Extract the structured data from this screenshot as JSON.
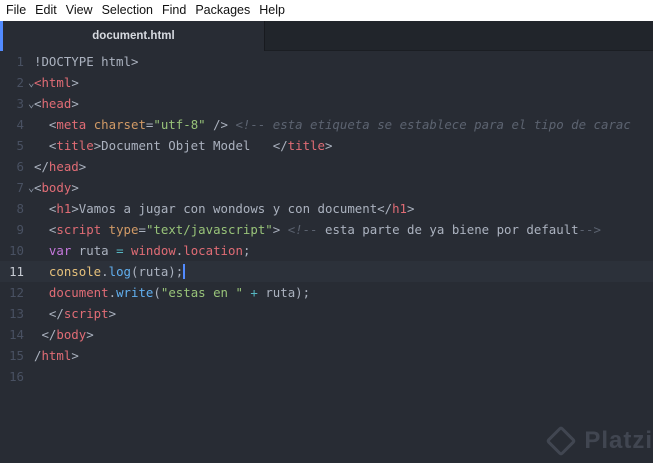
{
  "menu": [
    "File",
    "Edit",
    "View",
    "Selection",
    "Find",
    "Packages",
    "Help"
  ],
  "tab": {
    "title": "document.html"
  },
  "editor": {
    "current_line": 11,
    "lines": [
      {
        "n": "1",
        "fold": "",
        "tokens": [
          {
            "c": "c-txt",
            "t": "!DOCTYPE html>"
          }
        ]
      },
      {
        "n": "2",
        "fold": "⌄",
        "tokens": [
          {
            "c": "c-tag",
            "t": "<html"
          },
          {
            "c": "c-txt",
            "t": ">"
          }
        ]
      },
      {
        "n": "3",
        "fold": "⌄",
        "tokens": [
          {
            "c": "c-txt",
            "t": "<"
          },
          {
            "c": "c-tag",
            "t": "head"
          },
          {
            "c": "c-txt",
            "t": ">"
          }
        ]
      },
      {
        "n": "4",
        "fold": "",
        "tokens": [
          {
            "c": "c-txt",
            "t": "  <"
          },
          {
            "c": "c-tag",
            "t": "meta"
          },
          {
            "c": "c-txt",
            "t": " "
          },
          {
            "c": "c-attr",
            "t": "charset"
          },
          {
            "c": "c-txt",
            "t": "="
          },
          {
            "c": "c-str",
            "t": "\"utf-8\""
          },
          {
            "c": "c-txt",
            "t": " /> "
          },
          {
            "c": "c-com",
            "t": "<!-- esta etiqueta se establece para el tipo de carac"
          }
        ]
      },
      {
        "n": "5",
        "fold": "",
        "tokens": [
          {
            "c": "c-txt",
            "t": "  <"
          },
          {
            "c": "c-tag",
            "t": "title"
          },
          {
            "c": "c-txt",
            "t": ">Document Objet Model   </"
          },
          {
            "c": "c-tag",
            "t": "title"
          },
          {
            "c": "c-txt",
            "t": ">"
          }
        ]
      },
      {
        "n": "6",
        "fold": "",
        "tokens": [
          {
            "c": "c-txt",
            "t": "</"
          },
          {
            "c": "c-tag",
            "t": "head"
          },
          {
            "c": "c-txt",
            "t": ">"
          }
        ]
      },
      {
        "n": "7",
        "fold": "⌄",
        "tokens": [
          {
            "c": "c-txt",
            "t": "<"
          },
          {
            "c": "c-tag",
            "t": "body"
          },
          {
            "c": "c-txt",
            "t": ">"
          }
        ]
      },
      {
        "n": "8",
        "fold": "",
        "tokens": [
          {
            "c": "c-txt",
            "t": "  <"
          },
          {
            "c": "c-tag",
            "t": "h1"
          },
          {
            "c": "c-txt",
            "t": ">Vamos a jugar con wondows y con document</"
          },
          {
            "c": "c-tag",
            "t": "h1"
          },
          {
            "c": "c-txt",
            "t": ">"
          }
        ]
      },
      {
        "n": "9",
        "fold": "",
        "tokens": [
          {
            "c": "c-txt",
            "t": "  <"
          },
          {
            "c": "c-tag",
            "t": "script"
          },
          {
            "c": "c-txt",
            "t": " "
          },
          {
            "c": "c-attr",
            "t": "type"
          },
          {
            "c": "c-txt",
            "t": "="
          },
          {
            "c": "c-str",
            "t": "\"text/javascript\""
          },
          {
            "c": "c-txt",
            "t": "> "
          },
          {
            "c": "c-com",
            "t": "<!-- "
          },
          {
            "c": "c-txt",
            "t": "esta parte de ya biene por default"
          },
          {
            "c": "c-com",
            "t": "-->"
          }
        ]
      },
      {
        "n": "10",
        "fold": "",
        "tokens": [
          {
            "c": "c-txt",
            "t": "  "
          },
          {
            "c": "c-kw",
            "t": "var"
          },
          {
            "c": "c-txt",
            "t": " ruta "
          },
          {
            "c": "c-op",
            "t": "="
          },
          {
            "c": "c-txt",
            "t": " "
          },
          {
            "c": "c-var",
            "t": "window"
          },
          {
            "c": "c-txt",
            "t": "."
          },
          {
            "c": "c-var",
            "t": "location"
          },
          {
            "c": "c-txt",
            "t": ";"
          }
        ]
      },
      {
        "n": "11",
        "fold": "",
        "tokens": [
          {
            "c": "c-txt",
            "t": "  "
          },
          {
            "c": "c-obj",
            "t": "console"
          },
          {
            "c": "c-txt",
            "t": "."
          },
          {
            "c": "c-fn",
            "t": "log"
          },
          {
            "c": "c-txt",
            "t": "(ruta);"
          }
        ]
      },
      {
        "n": "12",
        "fold": "",
        "tokens": [
          {
            "c": "c-txt",
            "t": "  "
          },
          {
            "c": "c-var",
            "t": "document"
          },
          {
            "c": "c-txt",
            "t": "."
          },
          {
            "c": "c-fn",
            "t": "write"
          },
          {
            "c": "c-txt",
            "t": "("
          },
          {
            "c": "c-str",
            "t": "\"estas en \""
          },
          {
            "c": "c-txt",
            "t": " "
          },
          {
            "c": "c-op",
            "t": "+"
          },
          {
            "c": "c-txt",
            "t": " ruta);"
          }
        ]
      },
      {
        "n": "13",
        "fold": "",
        "tokens": [
          {
            "c": "c-txt",
            "t": "  </"
          },
          {
            "c": "c-tag",
            "t": "script"
          },
          {
            "c": "c-txt",
            "t": ">"
          }
        ]
      },
      {
        "n": "14",
        "fold": "",
        "tokens": [
          {
            "c": "c-txt",
            "t": " </"
          },
          {
            "c": "c-tag",
            "t": "body"
          },
          {
            "c": "c-txt",
            "t": ">"
          }
        ]
      },
      {
        "n": "15",
        "fold": "",
        "tokens": [
          {
            "c": "c-txt",
            "t": "/"
          },
          {
            "c": "c-tag",
            "t": "html"
          },
          {
            "c": "c-txt",
            "t": ">"
          }
        ]
      },
      {
        "n": "16",
        "fold": "",
        "tokens": []
      }
    ]
  },
  "watermark": {
    "text": "Platzi"
  }
}
